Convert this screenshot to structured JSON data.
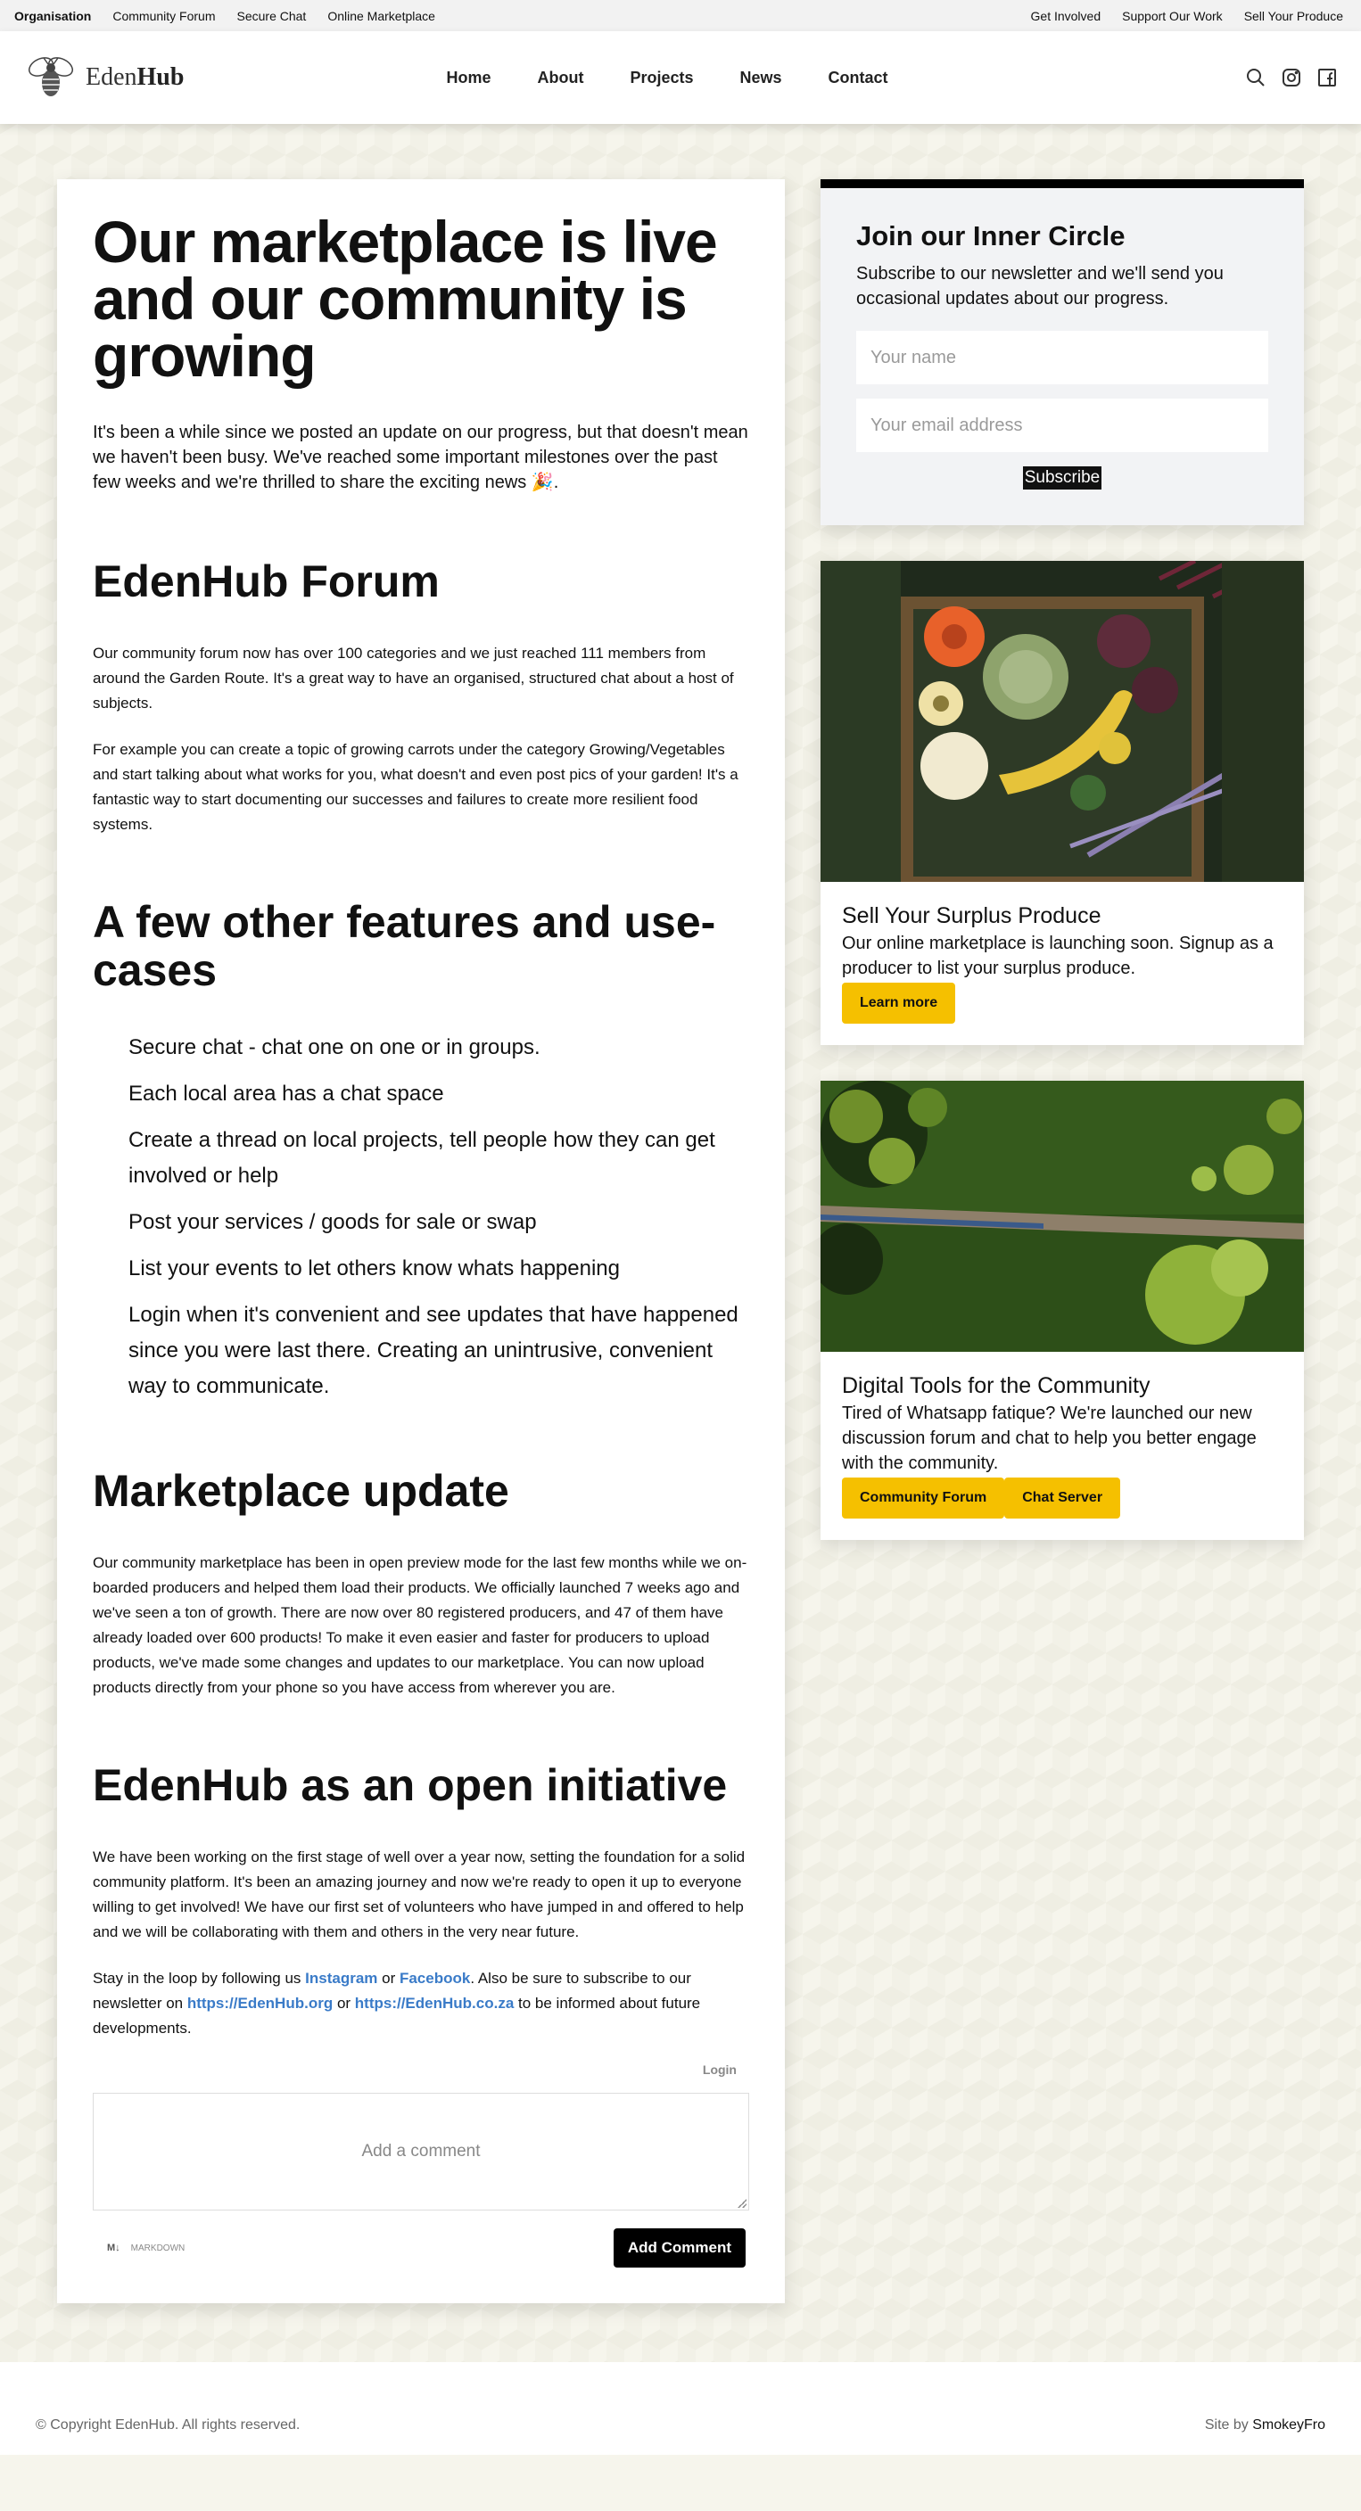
{
  "topbar": {
    "left": [
      "Organisation",
      "Community Forum",
      "Secure Chat",
      "Online Marketplace"
    ],
    "right": [
      "Get Involved",
      "Support Our Work",
      "Sell Your Produce"
    ]
  },
  "header": {
    "logo_prefix": "Eden",
    "logo_suffix": "Hub",
    "nav": [
      "Home",
      "About",
      "Projects",
      "News",
      "Contact"
    ],
    "icons": [
      "search-icon",
      "instagram-icon",
      "facebook-icon"
    ]
  },
  "article": {
    "title": "Our marketplace is live and our community is growing",
    "intro": "It's been a while since we posted an update on our progress, but that doesn't mean we haven't been busy. We've reached some important milestones over the past few weeks and we're thrilled to share the exciting news 🎉.",
    "forum": {
      "heading": "EdenHub Forum",
      "p1": "Our community forum now has over 100 categories and we just reached 111 members from around the Garden Route. It's a great way to have an organised, structured chat about a host of subjects.",
      "p2": "For example you can create a topic of growing carrots under the category Growing/Vegetables and start talking about what works for you, what doesn't and even post pics of your garden! It's a fantastic way to start documenting our successes and failures to create more resilient food systems."
    },
    "features": {
      "heading": "A few other features and use-cases",
      "items": [
        "Secure chat - chat one on one or in groups.",
        "Each local area has a chat space",
        "Create a thread on local projects, tell people how they can get involved or help",
        "Post your services / goods for sale or swap",
        "List your events to let others know whats happening",
        "Login when it's convenient and see updates that have happened since you were last there. Creating an unintrusive, convenient way to communicate."
      ]
    },
    "marketplace": {
      "heading": "Marketplace update",
      "p1": "Our community marketplace has been in open preview mode for the last few months while we on-boarded producers and helped them load their products. We officially launched 7 weeks ago and we've seen a ton of growth. There are now over 80 registered producers, and 47 of them have already loaded over 600 products! To make it even easier and faster for producers to upload products, we've made some changes and updates to our marketplace. You can now upload products directly from your phone so you have access from wherever you are."
    },
    "open": {
      "heading": "EdenHub as an open initiative",
      "p1": "We have been working on the first stage of well over a year now, setting the foundation for a solid community platform. It's been an amazing journey and now we're ready to open it up to everyone willing to get involved! We have our first set of volunteers who have jumped in and offered to help and we will be collaborating with them and others in the very near future.",
      "p2_a": "Stay in the loop by following us ",
      "link_instagram": "Instagram",
      "p2_b": " or ",
      "link_facebook": "Facebook",
      "p2_c": ". Also be sure to subscribe to our newsletter on ",
      "link_org": "https://EdenHub.org",
      "p2_d": " or ",
      "link_coza": "https://EdenHub.co.za",
      "p2_e": " to be informed about future developments."
    },
    "comments": {
      "login": "Login",
      "placeholder": "Add a comment",
      "md_icon": "M↓",
      "md_label": "MARKDOWN",
      "submit": "Add Comment"
    }
  },
  "sidebar": {
    "newsletter": {
      "title": "Join our Inner Circle",
      "text": "Subscribe to our newsletter and we'll send you occasional updates about our progress.",
      "name_placeholder": "Your name",
      "email_placeholder": "Your email address",
      "subscribe": "Subscribe"
    },
    "produce": {
      "title": "Sell Your Surplus Produce",
      "text": "Our online marketplace is launching soon. Signup as a producer to list your surplus produce.",
      "button": "Learn more"
    },
    "tools": {
      "title": "Digital Tools for the Community",
      "text": "Tired of Whatsapp fatique? We're launched our new discussion forum and chat to help you better engage with the community.",
      "buttons": [
        "Community Forum",
        "Chat Server"
      ]
    }
  },
  "footer": {
    "copyright": "© Copyright EdenHub. All rights reserved.",
    "siteby_label": "Site by ",
    "siteby_name": "SmokeyFro"
  },
  "colors": {
    "accent_yellow": "#f5c000",
    "link_blue": "#3a7bc8",
    "background": "#f6f5ec"
  }
}
